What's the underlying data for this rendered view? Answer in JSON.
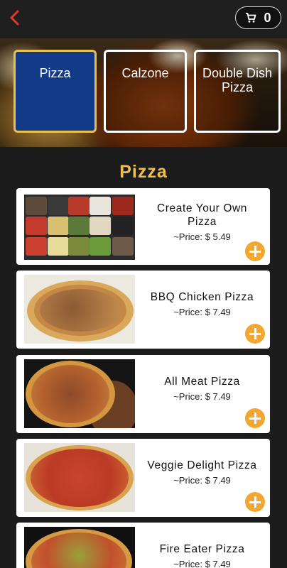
{
  "header": {
    "back_icon": "chevron-left-icon",
    "cart_icon": "shopping-cart-icon",
    "cart_count": "0",
    "accent_color": "#e2382b"
  },
  "categories": [
    {
      "label": "Pizza",
      "active": true
    },
    {
      "label": "Calzone",
      "active": false
    },
    {
      "label": "Double Dish Pizza",
      "active": false
    }
  ],
  "section_title": "Pizza",
  "items": [
    {
      "name": "Create Your Own Pizza",
      "price": "~Price: $ 5.49"
    },
    {
      "name": "BBQ Chicken Pizza",
      "price": "~Price: $ 7.49"
    },
    {
      "name": "All Meat Pizza",
      "price": "~Price: $ 7.49"
    },
    {
      "name": "Veggie Delight Pizza",
      "price": "~Price: $ 7.49"
    },
    {
      "name": "Fire Eater Pizza",
      "price": "~Price: $ 7.49"
    }
  ],
  "colors": {
    "title": "#efc04a",
    "active_tile": "#123a87",
    "active_border": "#e9c24e",
    "add_button": "#f3a630"
  }
}
